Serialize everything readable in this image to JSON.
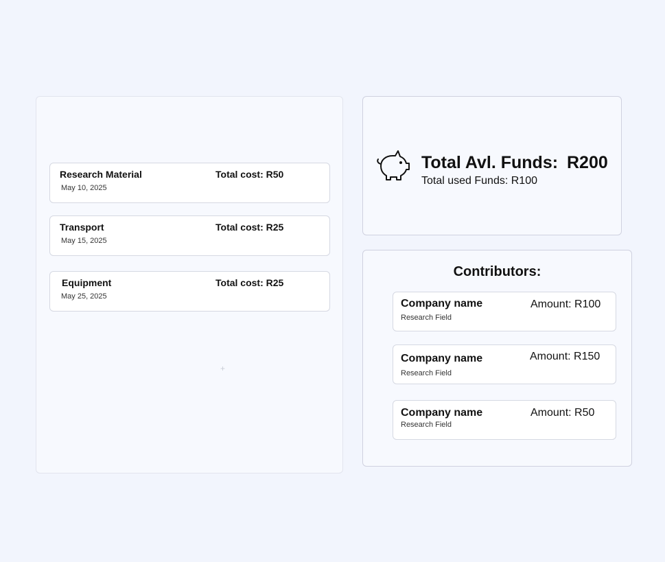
{
  "expenses": {
    "items": [
      {
        "name": "Research Material",
        "cost": "Total cost: R50",
        "date": "May 10, 2025"
      },
      {
        "name": "Transport",
        "cost": "Total cost: R25",
        "date": "May 15, 2025"
      },
      {
        "name": "Equipment",
        "cost": "Total cost: R25",
        "date": "May 25, 2025"
      }
    ]
  },
  "funds": {
    "icon": "piggy-bank-icon",
    "label": "Total Avl. Funds:",
    "value": "R200",
    "used": "Total used Funds: R100"
  },
  "contributors": {
    "title": "Contributors:",
    "items": [
      {
        "name": "Company name",
        "field": "Research Field",
        "amount": "Amount: R100"
      },
      {
        "name": "Company name",
        "field": "Research Field",
        "amount": "Amount: R150"
      },
      {
        "name": "Company name",
        "field": "Research Field",
        "amount": "Amount: R50"
      }
    ]
  },
  "colors": {
    "background": "#f2f5fd",
    "panel": "#f7f9fe",
    "card": "#ffffff",
    "border": "#d5d8e2"
  }
}
